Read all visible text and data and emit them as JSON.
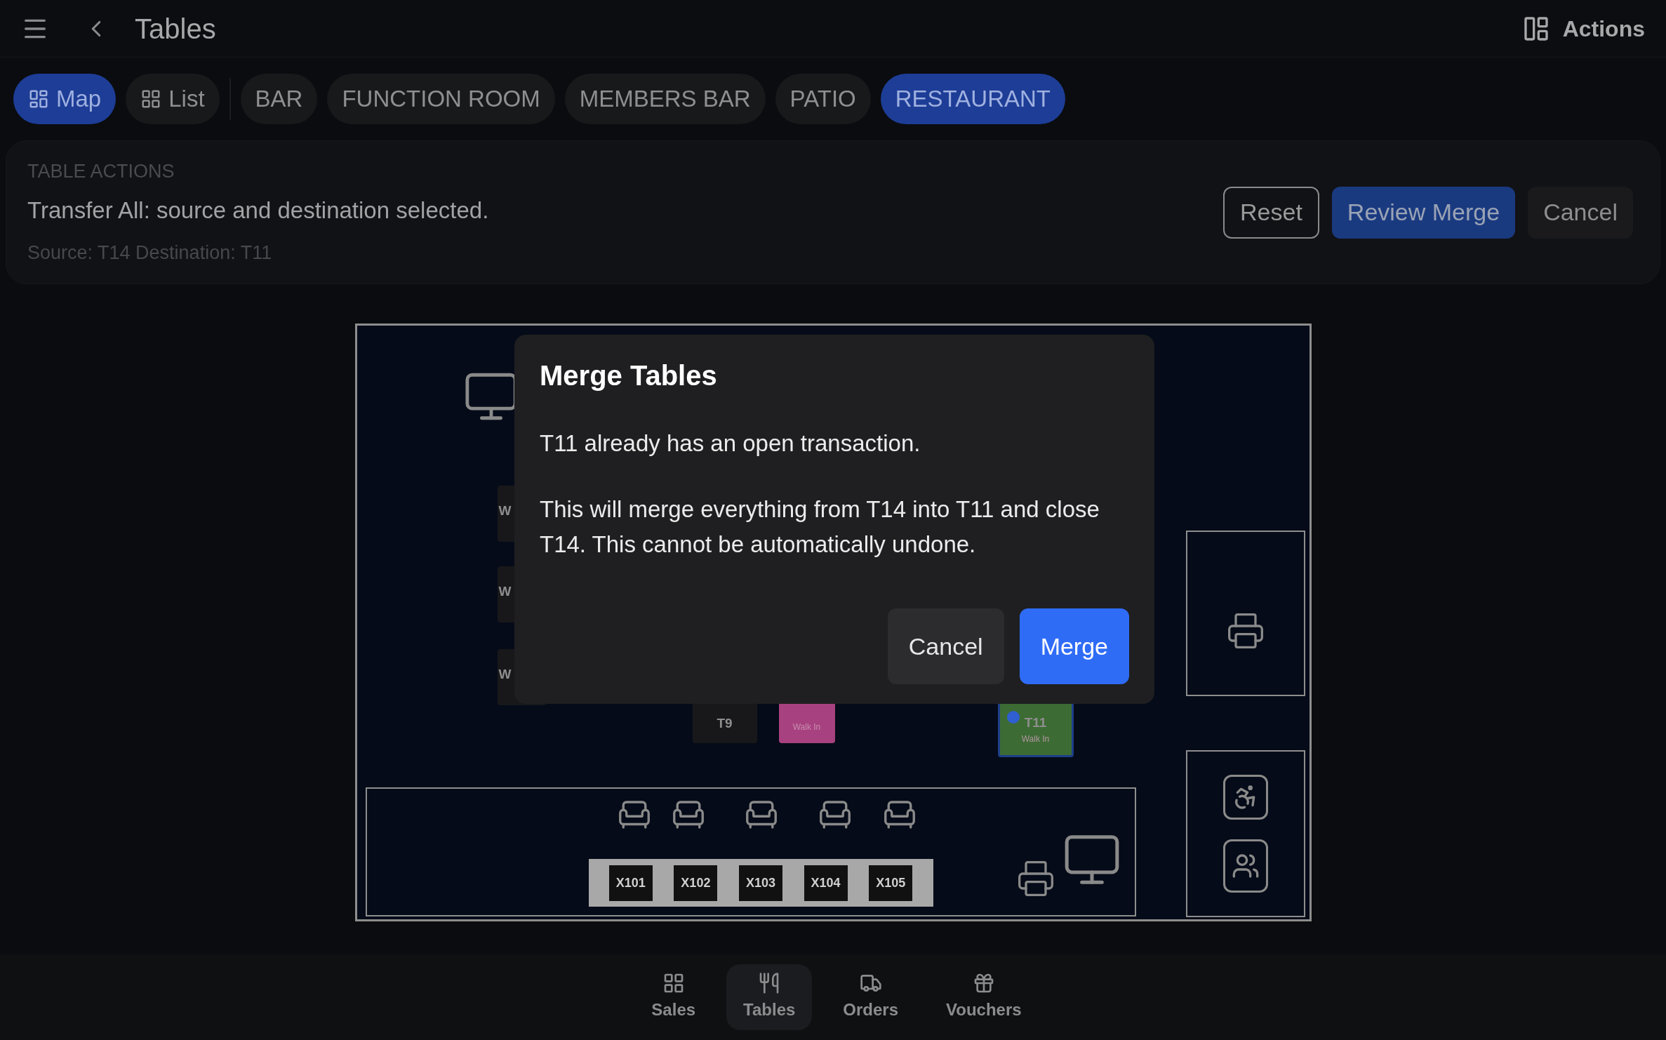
{
  "header": {
    "title": "Tables",
    "actions_label": "Actions"
  },
  "tabs": [
    {
      "label": "Map",
      "kind": "map",
      "selected": true
    },
    {
      "label": "List",
      "kind": "list",
      "selected": false
    },
    {
      "label": "BAR",
      "kind": "area",
      "selected": false
    },
    {
      "label": "FUNCTION ROOM",
      "kind": "area",
      "selected": false
    },
    {
      "label": "MEMBERS BAR",
      "kind": "area",
      "selected": false
    },
    {
      "label": "PATIO",
      "kind": "area",
      "selected": false
    },
    {
      "label": "RESTAURANT",
      "kind": "area",
      "selected": true
    }
  ],
  "table_actions": {
    "heading": "TABLE ACTIONS",
    "message": "Transfer All: source and destination selected.",
    "detail": "Source: T14 Destination: T11",
    "buttons": [
      {
        "label": "Reset",
        "kind": "outline"
      },
      {
        "label": "Review Merge",
        "kind": "primary"
      },
      {
        "label": "Cancel",
        "kind": "secondary"
      }
    ]
  },
  "floor_map": {
    "tables": [
      {
        "label": "W",
        "color": "#18181b",
        "selected": false,
        "indicator": false
      },
      {
        "label": "W",
        "color": "#18181b",
        "selected": false,
        "indicator": false
      },
      {
        "label": "W",
        "color": "#18181b",
        "selected": false,
        "indicator": false
      },
      {
        "label": "T9",
        "color": "#18181b",
        "selected": false,
        "indicator": false
      },
      {
        "subtitle": "Walk In",
        "color": "#a8417f",
        "selected": false,
        "indicator": false
      },
      {
        "label": "T11",
        "subtitle": "Walk In",
        "color": "#3d6b34",
        "selected": true,
        "indicator": true
      }
    ],
    "bar_seats": [
      "X101",
      "X102",
      "X103",
      "X104",
      "X105"
    ]
  },
  "dialog": {
    "title": "Merge Tables",
    "paragraphs": [
      "T11 already has an open transaction.",
      "This will merge everything from T14 into T11 and close T14. This cannot be automatically undone."
    ],
    "buttons": [
      {
        "label": "Cancel",
        "kind": "secondary"
      },
      {
        "label": "Merge",
        "kind": "primary"
      }
    ]
  },
  "bottom_nav": [
    {
      "label": "Sales",
      "kind": "sales",
      "selected": false
    },
    {
      "label": "Tables",
      "kind": "tables",
      "selected": true
    },
    {
      "label": "Orders",
      "kind": "orders",
      "selected": false
    },
    {
      "label": "Vouchers",
      "kind": "vouchers",
      "selected": false
    }
  ]
}
